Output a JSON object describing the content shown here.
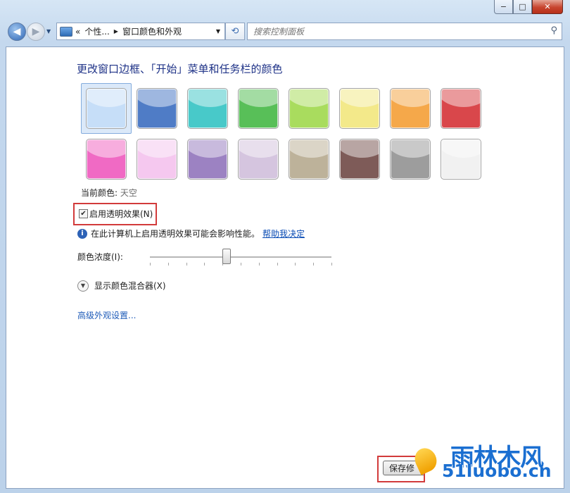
{
  "window": {
    "minimize_glyph": "−",
    "maximize_glyph": "□",
    "close_glyph": "✕"
  },
  "nav": {
    "back_glyph": "◀",
    "forward_glyph": "▶",
    "address_prefix": "«",
    "breadcrumb": [
      "个性...",
      "窗口颜色和外观"
    ],
    "search_placeholder": "搜索控制面板"
  },
  "page": {
    "title": "更改窗口边框、「开始」菜单和任务栏的颜色",
    "swatches": [
      {
        "name": "sky",
        "color": "#c6def8",
        "selected": true
      },
      {
        "name": "twilight",
        "color": "#4f7cc6"
      },
      {
        "name": "sea-foam",
        "color": "#48c9c9"
      },
      {
        "name": "leaf",
        "color": "#58bf58"
      },
      {
        "name": "lime",
        "color": "#a9dc5e"
      },
      {
        "name": "lemon",
        "color": "#f3e98a"
      },
      {
        "name": "orange",
        "color": "#f5a84a"
      },
      {
        "name": "ruby",
        "color": "#d9474b"
      },
      {
        "name": "fuchsia",
        "color": "#f06ac4"
      },
      {
        "name": "blush",
        "color": "#f5c8ef"
      },
      {
        "name": "violet",
        "color": "#9c82c2"
      },
      {
        "name": "lavender",
        "color": "#d5c5df"
      },
      {
        "name": "taupe",
        "color": "#bdb29a"
      },
      {
        "name": "chocolate",
        "color": "#7e5b58"
      },
      {
        "name": "slate",
        "color": "#9d9d9d"
      },
      {
        "name": "frost",
        "color": "#f1f1f1"
      }
    ],
    "current_color_label": "当前颜色:",
    "current_color_value": "天空",
    "transparency_checked": true,
    "transparency_label": "启用透明效果(N)",
    "info_text": "在此计算机上启用透明效果可能会影响性能。",
    "help_link": "帮助我决定",
    "density_label": "颜色浓度(I):",
    "density_value_fraction": 0.42,
    "mixer_label": "显示颜色混合器(X)",
    "advanced_link": "高级外观设置...",
    "save_label": "保存修"
  },
  "watermark": {
    "brand": "雨林木风",
    "url": "51luobo.cn"
  }
}
